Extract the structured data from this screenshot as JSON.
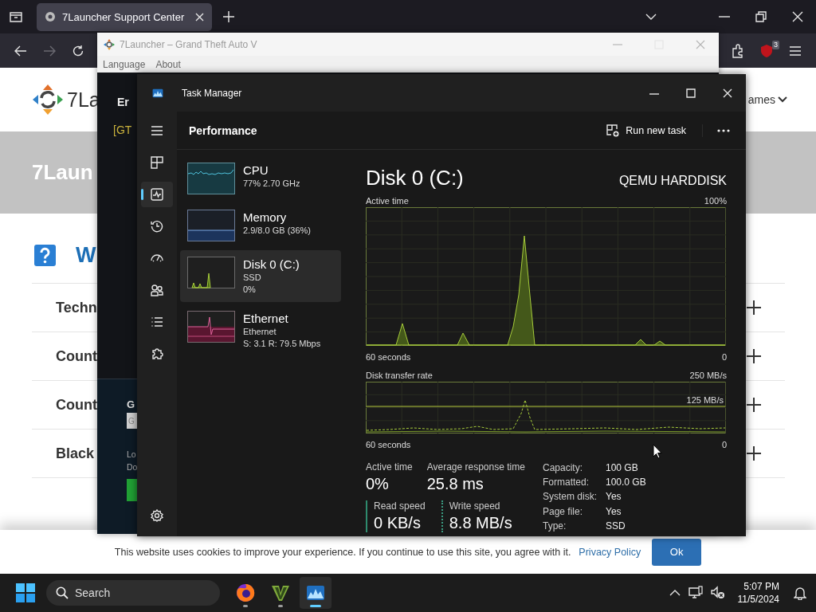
{
  "browser": {
    "tabs": [
      {
        "title": "7Launcher Support Center",
        "selected": true
      }
    ],
    "extension_badge": "3"
  },
  "website": {
    "logo_text": "7La",
    "nav_link": "ames",
    "hero_title": "7Laun",
    "section_title": "W",
    "faq_rows": [
      "Techn",
      "Count",
      "Count",
      "Black"
    ],
    "cookie_notice": {
      "text": "This website uses cookies to improve your experience. If you continue to use this site, you agree with it.",
      "link": "Privacy Policy",
      "button": "Ok"
    }
  },
  "launcher": {
    "title": "7Launcher – Grand Theft Auto V",
    "menu": [
      "Language",
      "About"
    ],
    "heading": "Er",
    "log_line": "[GT",
    "group_label": "G",
    "field_value": "G",
    "lines": [
      "Lo",
      "Do"
    ]
  },
  "task_manager": {
    "title": "Task Manager",
    "page_title": "Performance",
    "run_task": "Run new task",
    "nav": [
      {
        "kind": "menu",
        "selected": false
      },
      {
        "kind": "processes",
        "selected": false
      },
      {
        "kind": "performance",
        "selected": true
      },
      {
        "kind": "history",
        "selected": false
      },
      {
        "kind": "startup",
        "selected": false
      },
      {
        "kind": "users",
        "selected": false
      },
      {
        "kind": "details",
        "selected": false
      },
      {
        "kind": "services",
        "selected": false
      },
      {
        "kind": "settings",
        "selected": false
      }
    ],
    "resources": [
      {
        "kind": "cpu",
        "name": "CPU",
        "details": [
          "77% 2.70 GHz"
        ],
        "selected": false
      },
      {
        "kind": "memory",
        "name": "Memory",
        "details": [
          "2.9/8.0 GB (36%)"
        ],
        "selected": false
      },
      {
        "kind": "disk",
        "name": "Disk 0 (C:)",
        "details": [
          "SSD",
          "0%"
        ],
        "selected": true
      },
      {
        "kind": "ethernet",
        "name": "Ethernet",
        "details": [
          "Ethernet",
          "S: 3.1 R: 79.5 Mbps"
        ],
        "selected": false
      }
    ],
    "detail": {
      "title": "Disk 0 (C:)",
      "model": "QEMU HARDDISK",
      "graphs": [
        {
          "kind": "active",
          "label": "Active time",
          "max": "100%",
          "span": "60 seconds",
          "min": "0"
        },
        {
          "kind": "transfer",
          "label": "Disk transfer rate",
          "max": "250 MB/s",
          "mid": "125 MB/s",
          "span": "60 seconds",
          "min": "0"
        }
      ],
      "stats": [
        {
          "label": "Active time",
          "value": "0%"
        },
        {
          "label": "Average response time",
          "value": "25.8 ms"
        }
      ],
      "speeds": [
        {
          "kind": "read",
          "label": "Read speed",
          "value": "0 KB/s"
        },
        {
          "kind": "write",
          "label": "Write speed",
          "value": "8.8 MB/s"
        }
      ],
      "properties": [
        {
          "label": "Capacity:",
          "value": "100 GB"
        },
        {
          "label": "Formatted:",
          "value": "100.0 GB"
        },
        {
          "label": "System disk:",
          "value": "Yes"
        },
        {
          "label": "Page file:",
          "value": "Yes"
        },
        {
          "label": "Type:",
          "value": "SSD"
        }
      ]
    }
  },
  "taskbar": {
    "search_placeholder": "Search",
    "apps": [
      {
        "kind": "browser",
        "selected": false
      },
      {
        "kind": "launcher",
        "selected": false
      },
      {
        "kind": "monitor",
        "selected": true
      }
    ],
    "time": "5:07 PM",
    "date": "11/5/2024"
  }
}
